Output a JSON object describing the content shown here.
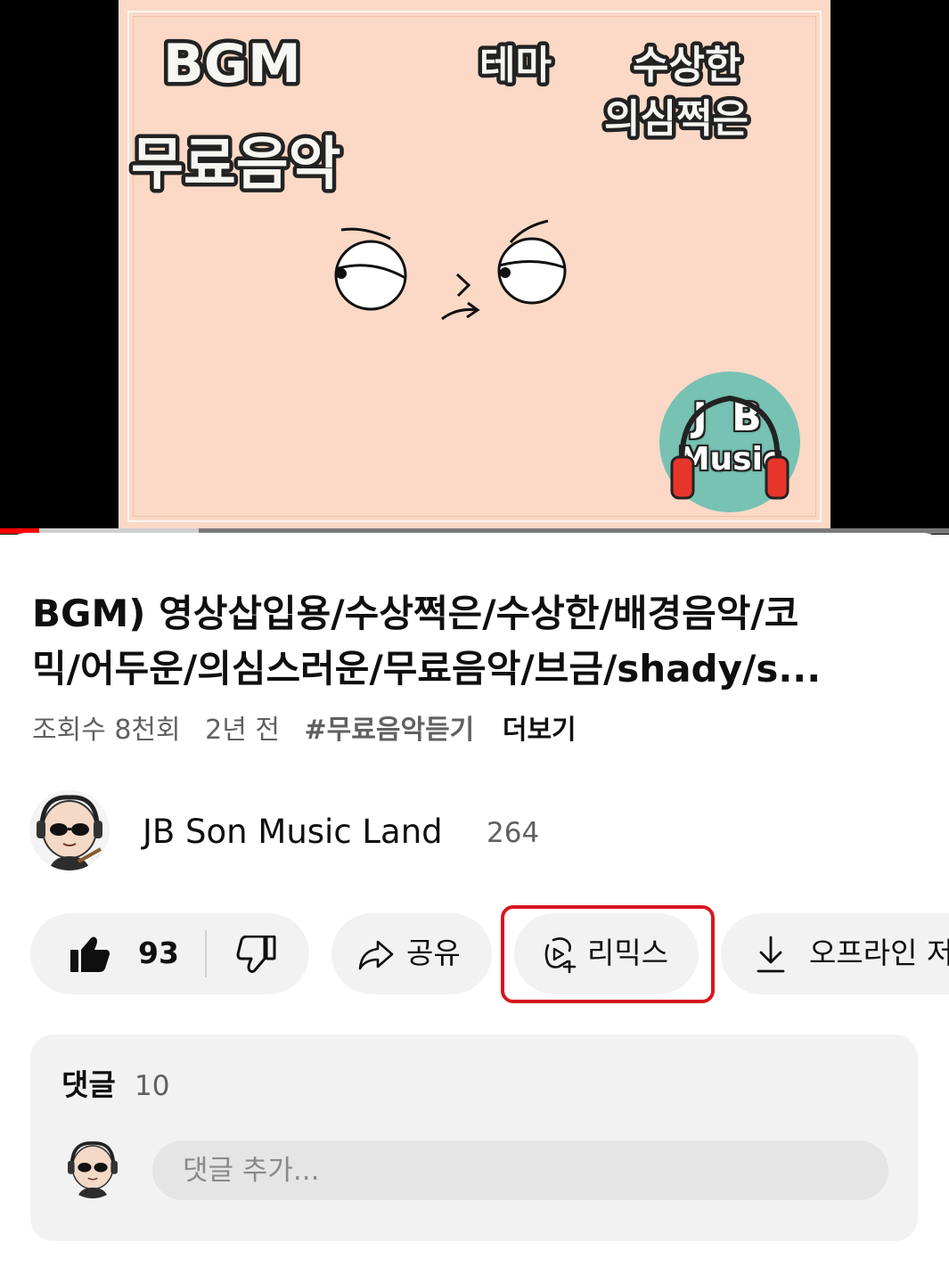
{
  "thumbnail": {
    "text_bgm": "BGM",
    "text_free_music": "무료음악",
    "text_theme": "테마",
    "text_suspicious": "수상한",
    "text_doubtful": "의심쩍은",
    "logo_jb": "J B",
    "logo_music": "Music"
  },
  "player": {
    "progress_fraction": 0.041,
    "buffered_fraction": 0.209
  },
  "video": {
    "title_line1": "BGM) 영상삽입용/수상쩍은/수상한/배경음악/코",
    "title_line2": "믹/어두운/의심스러운/무료음악/브금/shady/s...",
    "views": "조회수 8천회",
    "age": "2년 전",
    "hashtag": "#무료음악듣기",
    "more_label": "더보기"
  },
  "channel": {
    "name": "JB Son Music Land",
    "subscribers": "264"
  },
  "actions": {
    "like_count": "93",
    "share_label": "공유",
    "remix_label": "리믹스",
    "offline_label": "오프라인 저"
  },
  "comments": {
    "title": "댓글",
    "count": "10",
    "placeholder": "댓글 추가..."
  },
  "colors": {
    "accent_red": "#ff0000",
    "highlight_red": "#d8161f",
    "pill_bg": "#f2f2f2",
    "thumbnail_bg": "#fbd9c6"
  }
}
